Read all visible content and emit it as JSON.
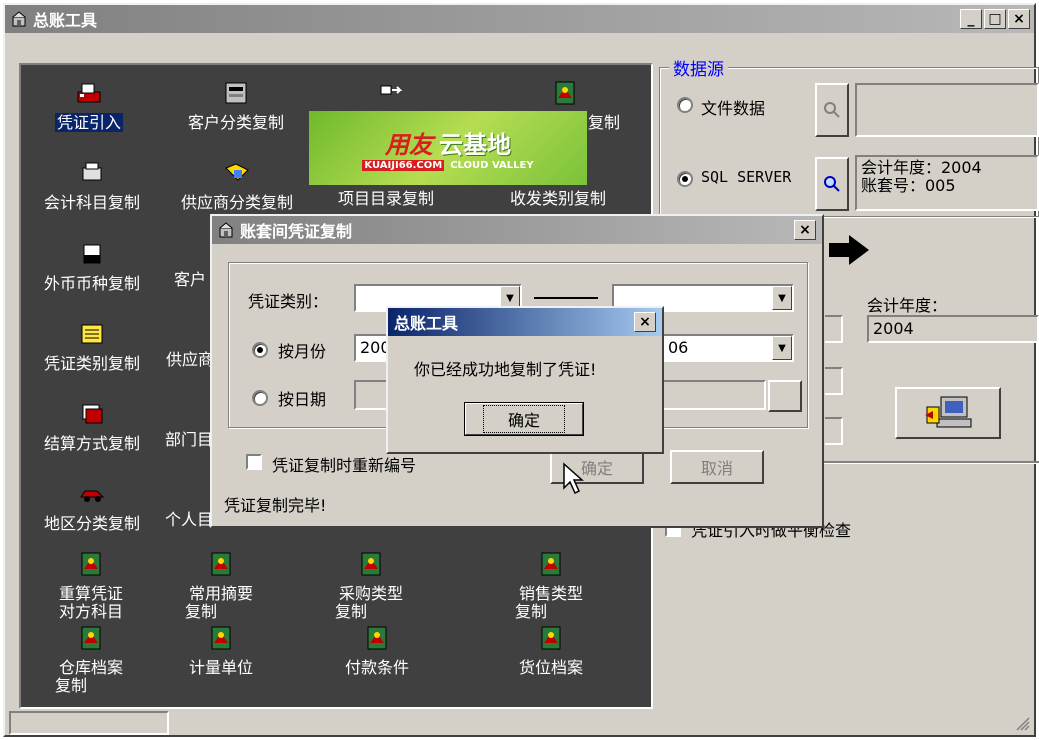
{
  "main_window": {
    "title": "总账工具",
    "caption_buttons": [
      "_",
      "□",
      "×"
    ]
  },
  "tools_panel": {
    "rows": [
      [
        "凭证引入",
        "客户分类复制",
        "",
        "复制"
      ],
      [
        "会计科目复制",
        "供应商分类复制",
        "项目目录复制",
        "收发类别复制"
      ],
      [
        "外币币种复制",
        "客户",
        "",
        ""
      ],
      [
        "凭证类别复制",
        "供应商",
        "",
        ""
      ],
      [
        "结算方式复制",
        "部门目",
        "",
        ""
      ],
      [
        "地区分类复制",
        "个人目",
        "",
        ""
      ]
    ],
    "bottom_items": [
      {
        "line1": "重算凭证",
        "line2": "对方科目"
      },
      {
        "line1": "常用摘要",
        "line2": "复制"
      },
      {
        "line1": "采购类型",
        "line2": "复制"
      },
      {
        "line1": "销售类型",
        "line2": "复制"
      },
      {
        "line1": "仓库档案",
        "line2": "复制"
      },
      {
        "line1": "计量单位",
        "line2": ""
      },
      {
        "line1": "付款条件",
        "line2": ""
      },
      {
        "line1": "货位档案",
        "line2": ""
      }
    ]
  },
  "logo": {
    "brand": "用友",
    "brand2": "云基地",
    "url_text": "KUAIJI66.COM",
    "sub_text": "CLOUD VALLEY"
  },
  "data_source": {
    "group_label": "数据源",
    "file_option": "文件数据",
    "sql_option": "SQL SERVER",
    "sql_info_line1": "会计年度：2004",
    "sql_info_line2": "账套号：005",
    "year_label": "会计年度：",
    "year_value": "2004",
    "balance_check_label": "凭证引入时做平衡检查"
  },
  "copy_dialog": {
    "title": "账套间凭证复制",
    "voucher_type_label": "凭证类别：",
    "voucher_type_value": "",
    "voucher_type_value2": "",
    "by_month_label": "按月份",
    "month_from_value": "200",
    "month_to_value": "06",
    "by_date_label": "按日期",
    "renumber_label": "凭证复制时重新编号",
    "ok_label": "确定",
    "cancel_label": "取消",
    "status_text": "凭证复制完毕!"
  },
  "message_box": {
    "title": "总账工具",
    "message": "你已经成功地复制了凭证!",
    "ok_label": "确定"
  },
  "colors": {
    "panel_bg": "#404040",
    "selected_bg": "#0a246a",
    "window_bg": "#d4d0c8",
    "title_active": "#0a246a",
    "title_inactive": "#808080",
    "group_label_color": "#0000ff"
  }
}
